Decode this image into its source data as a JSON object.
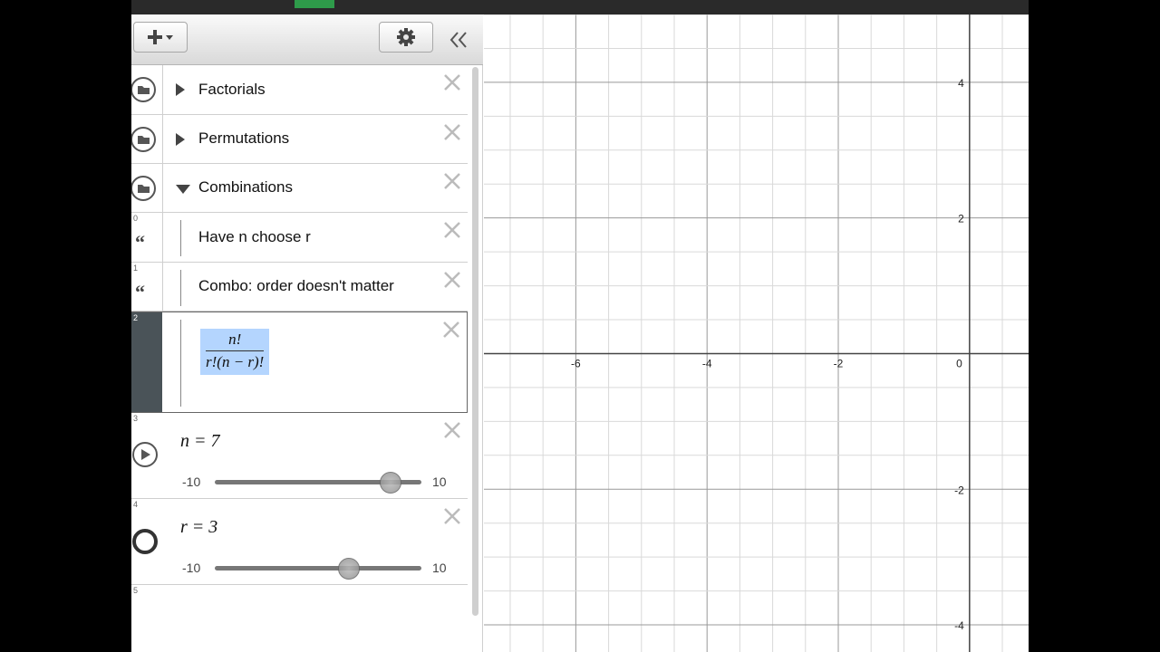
{
  "toolbar": {
    "add_icon": "plus-icon",
    "settings_icon": "gear-icon",
    "collapse_icon": "double-chevron-left-icon"
  },
  "expressions": [
    {
      "type": "folder",
      "label": "Factorials",
      "expanded": false
    },
    {
      "type": "folder",
      "label": "Permutations",
      "expanded": false
    },
    {
      "type": "folder",
      "label": "Combinations",
      "expanded": true
    },
    {
      "type": "note",
      "index": "0",
      "label": "Have n choose r"
    },
    {
      "type": "note",
      "index": "1",
      "label": "Combo: order doesn't matter"
    },
    {
      "type": "expression",
      "index": "2",
      "numerator": "n!",
      "denominator": "r!(n − r)!",
      "selected": true
    },
    {
      "type": "slider",
      "index": "3",
      "equation": "n = 7",
      "min": "-10",
      "max": "10",
      "value": 7
    },
    {
      "type": "slider",
      "index": "4",
      "equation": "r = 3",
      "min": "-10",
      "max": "10",
      "value": 3
    },
    {
      "type": "empty",
      "index": "5"
    }
  ],
  "graph": {
    "x_ticks": [
      "-6",
      "-4",
      "-2",
      "0"
    ],
    "y_ticks": [
      "4",
      "2",
      "-2",
      "-4"
    ],
    "x_range": [
      -7.4,
      0.9
    ],
    "y_range": [
      -4.4,
      5.0
    ],
    "grid_color": "#d9d9d9",
    "major_grid_color": "#999999",
    "axis_color": "#444444"
  }
}
